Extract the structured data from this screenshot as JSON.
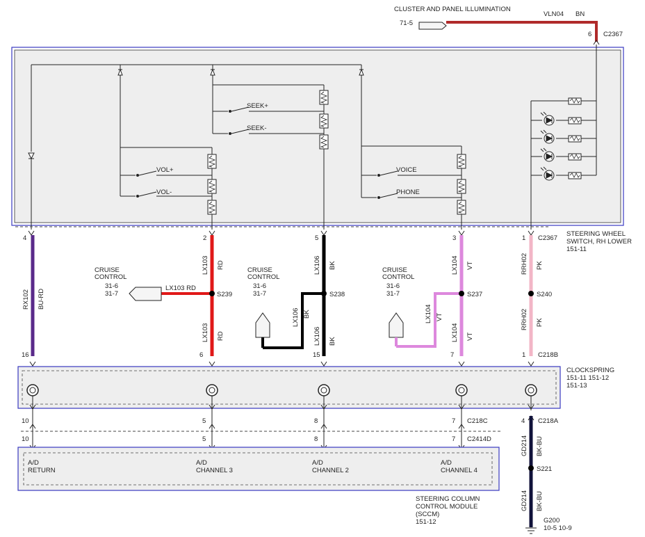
{
  "top": {
    "cluster_label": "CLUSTER AND PANEL ILLUMINATION",
    "cluster_ref": "71-5",
    "vln_circuit": "VLN04",
    "vln_color": "BN",
    "c2367_pin": "6",
    "c2367_label": "C2367"
  },
  "switch_module": {
    "seek_plus": "SEEK+",
    "seek_minus": "SEEK-",
    "vol_plus": "VOL+",
    "vol_minus": "VOL-",
    "voice": "VOICE",
    "phone": "PHONE",
    "name_line1": "STEERING WHEEL",
    "name_line2": "SWITCH, RH LOWER",
    "name_ref": "151-11"
  },
  "pins_top": {
    "p4": "4",
    "p2": "2",
    "p5": "5",
    "p3": "3",
    "p1": "1",
    "c2367": "C2367"
  },
  "wires": {
    "rx102": "RX102",
    "bu_rd": "BU-RD",
    "lx103": "LX103",
    "rd": "RD",
    "lx106": "LX106",
    "bk": "BK",
    "lx104": "LX104",
    "vt": "VT",
    "rrh02": "RRH02",
    "pk": "PK",
    "lx103_rd_combined": "LX103  RD"
  },
  "splices": {
    "s239": "S239",
    "s238": "S238",
    "s237": "S237",
    "s240": "S240",
    "s221": "S221"
  },
  "cruise": {
    "line1": "CRUISE",
    "line2": "CONTROL",
    "ref1": "31-6",
    "ref2": "31-7"
  },
  "pins_mid": {
    "p16": "16",
    "p6": "6",
    "p15": "15",
    "p7": "7",
    "p1": "1",
    "c218b": "C218B"
  },
  "clockspring": {
    "name": "CLOCKSPRING",
    "ref1": "151-11  151-12",
    "ref2": "151-13"
  },
  "pins_bottom": {
    "p10": "10",
    "p5": "5",
    "p8": "8",
    "p7": "7",
    "p4": "4",
    "c218c": "C218C",
    "c2414d": "C2414D",
    "c218a": "C218A"
  },
  "gd214": {
    "circuit": "GD214",
    "color": "BK-BU"
  },
  "ground": {
    "name": "G200",
    "ref": "10-5   10-9"
  },
  "sccm": {
    "ad": "A/D",
    "return": "RETURN",
    "ch3": "CHANNEL 3",
    "ch2": "CHANNEL 2",
    "ch4": "CHANNEL 4",
    "name1": "STEERING COLUMN",
    "name2": "CONTROL MODULE",
    "name3": "(SCCM)",
    "ref": "151-12"
  },
  "colors": {
    "bu_rd": "#5a2a8a",
    "rd": "#e01818",
    "bk": "#000000",
    "vt": "#dd88dd",
    "pk": "#f2b6c6",
    "bn": "#b02a2a",
    "bk_bu": "#10123a",
    "box_stroke": "#3838c0",
    "box_fill": "#eeeeee"
  }
}
